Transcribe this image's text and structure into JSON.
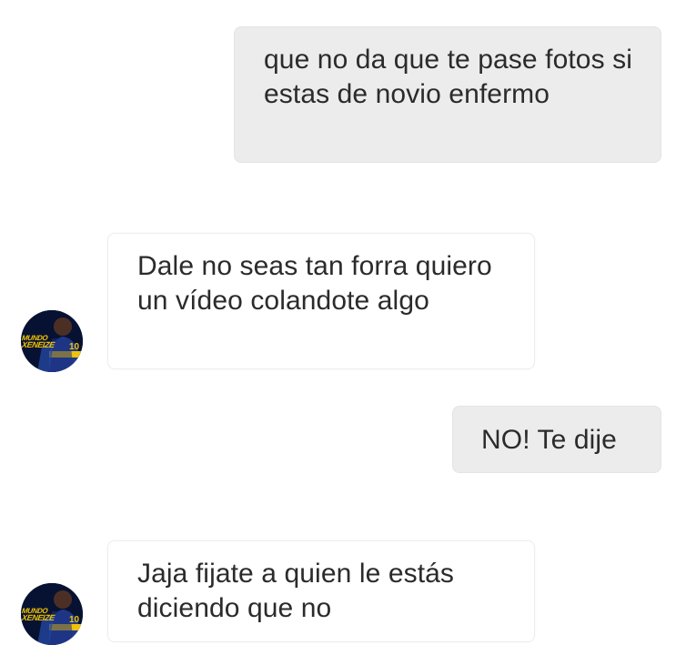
{
  "conversation": {
    "messages": [
      {
        "direction": "outgoing",
        "text": "que no da que te pase fotos si estas de novio enfermo"
      },
      {
        "direction": "incoming",
        "text": "Dale no seas tan forra quiero un vídeo colandote algo"
      },
      {
        "direction": "outgoing",
        "text": "NO! Te dije"
      },
      {
        "direction": "incoming",
        "text": "Jaja fijate a quien le estás diciendo que no"
      }
    ]
  },
  "contact": {
    "avatar": {
      "text_top": "MUNDO",
      "text_bottom": "XENEIZE",
      "jersey_number": "10"
    }
  },
  "colors": {
    "outgoing_bubble": "#ececec",
    "incoming_bubble": "#ffffff",
    "avatar_background": "#071233",
    "avatar_text": "#f2c400"
  }
}
